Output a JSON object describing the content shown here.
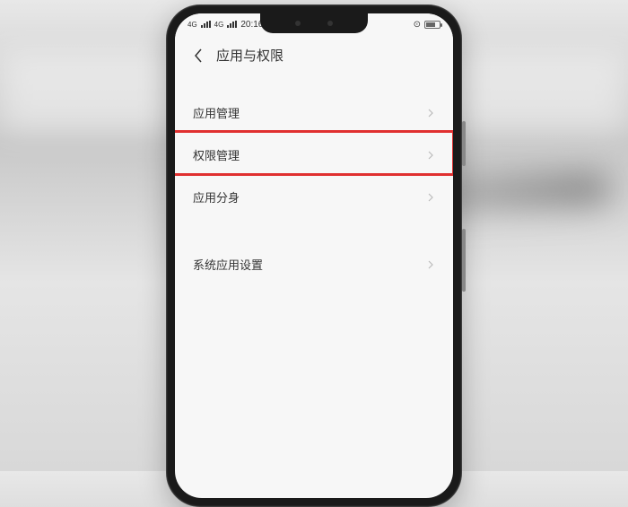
{
  "status_bar": {
    "network_label_1": "4G",
    "network_label_2": "4G",
    "time": "20:16",
    "battery_percent": 60
  },
  "header": {
    "title": "应用与权限"
  },
  "menu": {
    "items": [
      {
        "label": "应用管理"
      },
      {
        "label": "权限管理"
      },
      {
        "label": "应用分身"
      }
    ],
    "secondary": [
      {
        "label": "系统应用设置"
      }
    ]
  },
  "highlight": {
    "target_index": 1,
    "color": "#e03030"
  }
}
